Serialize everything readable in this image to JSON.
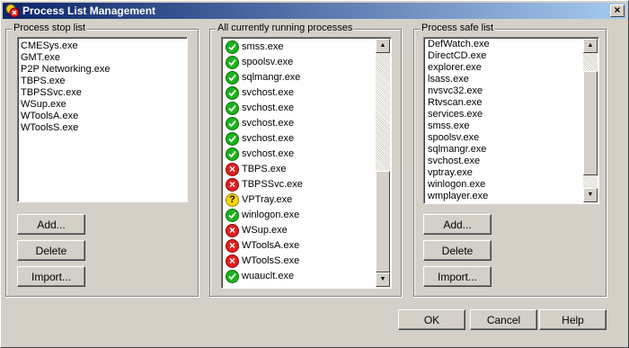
{
  "window": {
    "title": "Process List Management"
  },
  "stop_list": {
    "label": "Process stop list",
    "items": [
      "CMESys.exe",
      "GMT.exe",
      "P2P Networking.exe",
      "TBPS.exe",
      "TBPSSvc.exe",
      "WSup.exe",
      "WToolsA.exe",
      "WToolsS.exe"
    ],
    "buttons": {
      "add": "Add...",
      "delete": "Delete",
      "import": "Import..."
    }
  },
  "running": {
    "label": "All currently running processes",
    "items": [
      {
        "name": "smss.exe",
        "status": "ok"
      },
      {
        "name": "spoolsv.exe",
        "status": "ok"
      },
      {
        "name": "sqlmangr.exe",
        "status": "ok"
      },
      {
        "name": "svchost.exe",
        "status": "ok"
      },
      {
        "name": "svchost.exe",
        "status": "ok"
      },
      {
        "name": "svchost.exe",
        "status": "ok"
      },
      {
        "name": "svchost.exe",
        "status": "ok"
      },
      {
        "name": "svchost.exe",
        "status": "ok"
      },
      {
        "name": "TBPS.exe",
        "status": "bad"
      },
      {
        "name": "TBPSSvc.exe",
        "status": "bad"
      },
      {
        "name": "VPTray.exe",
        "status": "unknown"
      },
      {
        "name": "winlogon.exe",
        "status": "ok"
      },
      {
        "name": "WSup.exe",
        "status": "bad"
      },
      {
        "name": "WToolsA.exe",
        "status": "bad"
      },
      {
        "name": "WToolsS.exe",
        "status": "bad"
      },
      {
        "name": "wuauclt.exe",
        "status": "ok"
      }
    ],
    "status_icons": {
      "ok": "check-icon",
      "bad": "x-icon",
      "unknown": "question-icon"
    },
    "scroll_position": 1.0
  },
  "safe_list": {
    "label": "Process safe list",
    "items": [
      "DefWatch.exe",
      "DirectCD.exe",
      "explorer.exe",
      "lsass.exe",
      "nvsvc32.exe",
      "Rtvscan.exe",
      "services.exe",
      "smss.exe",
      "spoolsv.exe",
      "sqlmangr.exe",
      "svchost.exe",
      "vptray.exe",
      "winlogon.exe",
      "wmplayer.exe"
    ],
    "buttons": {
      "add": "Add...",
      "delete": "Delete",
      "import": "Import..."
    },
    "scroll_position": 1.0
  },
  "dialog_buttons": {
    "ok": "OK",
    "cancel": "Cancel",
    "help": "Help"
  },
  "colors": {
    "titlebar_start": "#0a246a",
    "titlebar_end": "#a6caf0",
    "face": "#d4d0c8",
    "ok": "#19b419",
    "bad": "#e02020",
    "unknown": "#ffd400"
  }
}
